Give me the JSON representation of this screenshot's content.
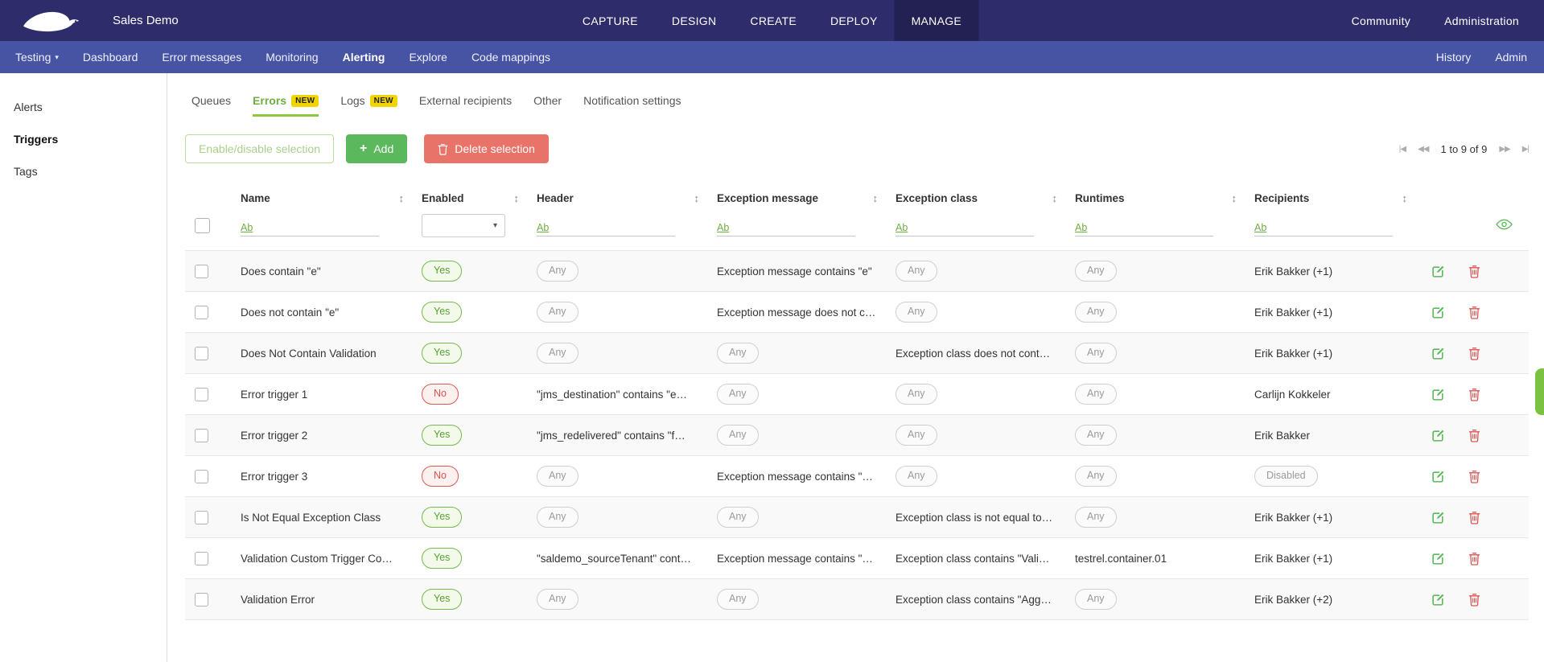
{
  "colors": {
    "topbar": "#2e2c6a",
    "topbar_active": "#232153",
    "subnav": "#4754a3",
    "green": "#5cb85c",
    "green_text": "#6fae41",
    "red": "#d9534f",
    "salmon": "#e87368",
    "yellow": "#f2d500",
    "row_alt": "#f9f9f9"
  },
  "icons": {
    "plus": "+",
    "caret_down": "▾",
    "sort": "↕",
    "pager_first": "|◀",
    "pager_prev": "◀◀",
    "pager_next": "▶▶",
    "pager_last": "▶|"
  },
  "topbar": {
    "brand": "Sales Demo",
    "menu": [
      {
        "label": "CAPTURE",
        "active": false
      },
      {
        "label": "DESIGN",
        "active": false
      },
      {
        "label": "CREATE",
        "active": false
      },
      {
        "label": "DEPLOY",
        "active": false
      },
      {
        "label": "MANAGE",
        "active": true
      }
    ],
    "right_menu": [
      {
        "label": "Community"
      },
      {
        "label": "Administration"
      }
    ]
  },
  "subnav": {
    "items": [
      {
        "label": "Testing",
        "caret": true,
        "active": false
      },
      {
        "label": "Dashboard",
        "active": false
      },
      {
        "label": "Error messages",
        "active": false
      },
      {
        "label": "Monitoring",
        "active": false
      },
      {
        "label": "Alerting",
        "active": true
      },
      {
        "label": "Explore",
        "active": false
      },
      {
        "label": "Code mappings",
        "active": false
      }
    ],
    "right_items": [
      {
        "label": "History"
      },
      {
        "label": "Admin"
      }
    ]
  },
  "sidebar": {
    "items": [
      {
        "label": "Alerts",
        "active": false
      },
      {
        "label": "Triggers",
        "active": true
      },
      {
        "label": "Tags",
        "active": false
      }
    ]
  },
  "tabs": [
    {
      "label": "Queues",
      "active": false
    },
    {
      "label": "Errors",
      "badge": "NEW",
      "active": true
    },
    {
      "label": "Logs",
      "badge": "NEW",
      "active": false
    },
    {
      "label": "External recipients",
      "active": false
    },
    {
      "label": "Other",
      "active": false
    },
    {
      "label": "Notification settings",
      "active": false
    }
  ],
  "toolbar": {
    "enable_disable_label": "Enable/disable selection",
    "add_label": "Add",
    "delete_label": "Delete selection"
  },
  "pagination": {
    "range_text": "1 to 9 of 9"
  },
  "table": {
    "filter_prefix": "Ab",
    "columns": [
      {
        "key": "name",
        "label": "Name",
        "filter": "text"
      },
      {
        "key": "enabled",
        "label": "Enabled",
        "filter": "select"
      },
      {
        "key": "header",
        "label": "Header",
        "filter": "text"
      },
      {
        "key": "exception_message",
        "label": "Exception message",
        "filter": "text"
      },
      {
        "key": "exception_class",
        "label": "Exception class",
        "filter": "text"
      },
      {
        "key": "runtimes",
        "label": "Runtimes",
        "filter": "text"
      },
      {
        "key": "recipients",
        "label": "Recipients",
        "filter": "text"
      }
    ],
    "rows": [
      {
        "name": "Does contain \"e\"",
        "enabled": "Yes",
        "header": {
          "pill": true,
          "text": "Any"
        },
        "exception_message": {
          "pill": false,
          "text": "Exception message contains \"e\""
        },
        "exception_class": {
          "pill": true,
          "text": "Any"
        },
        "runtimes": {
          "pill": true,
          "text": "Any"
        },
        "recipients": {
          "pill": false,
          "text": "Erik Bakker (+1)"
        }
      },
      {
        "name": "Does not contain \"e\"",
        "enabled": "Yes",
        "header": {
          "pill": true,
          "text": "Any"
        },
        "exception_message": {
          "pill": false,
          "text": "Exception message does not c…"
        },
        "exception_class": {
          "pill": true,
          "text": "Any"
        },
        "runtimes": {
          "pill": true,
          "text": "Any"
        },
        "recipients": {
          "pill": false,
          "text": "Erik Bakker (+1)"
        }
      },
      {
        "name": "Does Not Contain Validation",
        "enabled": "Yes",
        "header": {
          "pill": true,
          "text": "Any"
        },
        "exception_message": {
          "pill": true,
          "text": "Any"
        },
        "exception_class": {
          "pill": false,
          "text": "Exception class does not cont…"
        },
        "runtimes": {
          "pill": true,
          "text": "Any"
        },
        "recipients": {
          "pill": false,
          "text": "Erik Bakker (+1)"
        }
      },
      {
        "name": "Error trigger 1",
        "enabled": "No",
        "header": {
          "pill": false,
          "text": "\"jms_destination\" contains \"e…"
        },
        "exception_message": {
          "pill": true,
          "text": "Any"
        },
        "exception_class": {
          "pill": true,
          "text": "Any"
        },
        "runtimes": {
          "pill": true,
          "text": "Any"
        },
        "recipients": {
          "pill": false,
          "text": "Carlijn Kokkeler"
        }
      },
      {
        "name": "Error trigger 2",
        "enabled": "Yes",
        "header": {
          "pill": false,
          "text": "\"jms_redelivered\" contains \"f…"
        },
        "exception_message": {
          "pill": true,
          "text": "Any"
        },
        "exception_class": {
          "pill": true,
          "text": "Any"
        },
        "runtimes": {
          "pill": true,
          "text": "Any"
        },
        "recipients": {
          "pill": false,
          "text": "Erik Bakker"
        }
      },
      {
        "name": "Error trigger 3",
        "enabled": "No",
        "header": {
          "pill": true,
          "text": "Any"
        },
        "exception_message": {
          "pill": false,
          "text": "Exception message contains \"…"
        },
        "exception_class": {
          "pill": true,
          "text": "Any"
        },
        "runtimes": {
          "pill": true,
          "text": "Any"
        },
        "recipients": {
          "pill": true,
          "text": "Disabled"
        }
      },
      {
        "name": "Is Not Equal Exception Class",
        "enabled": "Yes",
        "header": {
          "pill": true,
          "text": "Any"
        },
        "exception_message": {
          "pill": true,
          "text": "Any"
        },
        "exception_class": {
          "pill": false,
          "text": "Exception class is not equal to…"
        },
        "runtimes": {
          "pill": true,
          "text": "Any"
        },
        "recipients": {
          "pill": false,
          "text": "Erik Bakker (+1)"
        }
      },
      {
        "name": "Validation Custom Trigger Co…",
        "enabled": "Yes",
        "header": {
          "pill": false,
          "text": "\"saldemo_sourceTenant\" cont…"
        },
        "exception_message": {
          "pill": false,
          "text": "Exception message contains \"…"
        },
        "exception_class": {
          "pill": false,
          "text": "Exception class contains \"Vali…"
        },
        "runtimes": {
          "pill": false,
          "text": "testrel.container.01"
        },
        "recipients": {
          "pill": false,
          "text": "Erik Bakker (+1)"
        }
      },
      {
        "name": "Validation Error",
        "enabled": "Yes",
        "header": {
          "pill": true,
          "text": "Any"
        },
        "exception_message": {
          "pill": true,
          "text": "Any"
        },
        "exception_class": {
          "pill": false,
          "text": "Exception class contains \"Agg…"
        },
        "runtimes": {
          "pill": true,
          "text": "Any"
        },
        "recipients": {
          "pill": false,
          "text": "Erik Bakker (+2)"
        }
      }
    ]
  }
}
